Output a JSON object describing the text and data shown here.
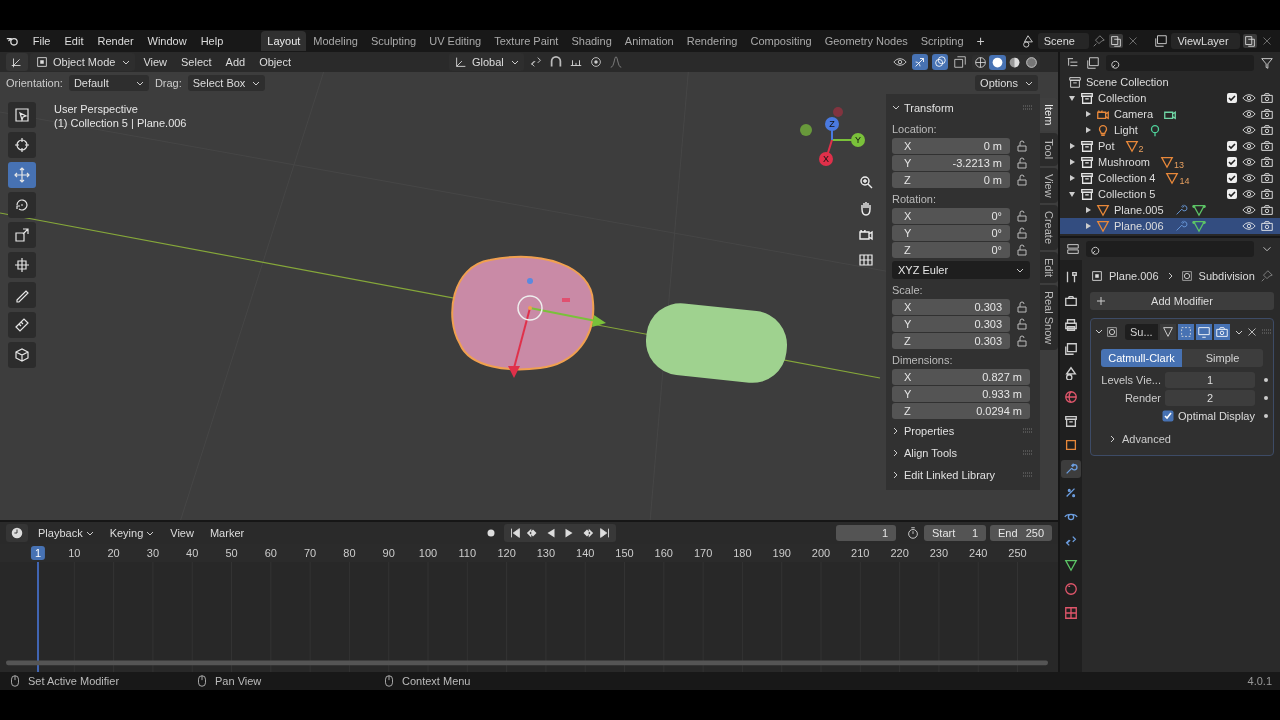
{
  "top_bar": {
    "menus": [
      "File",
      "Edit",
      "Render",
      "Window",
      "Help"
    ],
    "workspaces": [
      {
        "label": "Layout",
        "selected": true
      },
      {
        "label": "Modeling",
        "selected": false
      },
      {
        "label": "Sculpting",
        "selected": false
      },
      {
        "label": "UV Editing",
        "selected": false
      },
      {
        "label": "Texture Paint",
        "selected": false
      },
      {
        "label": "Shading",
        "selected": false
      },
      {
        "label": "Animation",
        "selected": false
      },
      {
        "label": "Rendering",
        "selected": false
      },
      {
        "label": "Compositing",
        "selected": false
      },
      {
        "label": "Geometry Nodes",
        "selected": false
      },
      {
        "label": "Scripting",
        "selected": false
      }
    ],
    "add_workspace": "+",
    "scene": "Scene",
    "view_layer": "ViewLayer"
  },
  "viewport": {
    "mode": "Object Mode",
    "menus": [
      "View",
      "Select",
      "Add",
      "Object"
    ],
    "transform_orientation": "Global",
    "gizmos_on": true,
    "overlays_on": true,
    "shading": [
      {
        "kind": "wireframe",
        "selected": false
      },
      {
        "kind": "solid",
        "selected": true
      },
      {
        "kind": "material",
        "selected": false
      },
      {
        "kind": "rendered",
        "selected": false
      }
    ],
    "orientation_label": "Orientation:",
    "orientation": "Default",
    "drag_label": "Drag:",
    "drag": "Select Box",
    "options": "Options",
    "gizmo_axes": [
      "X",
      "Y",
      "Z"
    ],
    "view_name": "User Perspective",
    "context": "(1) Collection 5 | Plane.006",
    "tools": [
      {
        "kind": "select",
        "selected": false
      },
      {
        "kind": "cursor",
        "selected": false
      },
      {
        "kind": "move",
        "selected": true
      },
      {
        "kind": "rotate",
        "selected": false
      },
      {
        "kind": "scale",
        "selected": false
      },
      {
        "kind": "transform",
        "selected": false
      },
      {
        "kind": "annotate",
        "selected": false
      },
      {
        "kind": "measure",
        "selected": false
      },
      {
        "kind": "add_cube",
        "selected": false
      }
    ]
  },
  "sidebar": {
    "tabs": [
      {
        "label": "Item",
        "selected": true
      },
      {
        "label": "Tool",
        "selected": false
      },
      {
        "label": "View",
        "selected": false
      },
      {
        "label": "Create",
        "selected": false
      },
      {
        "label": "Edit",
        "selected": false
      },
      {
        "label": "Real Snow",
        "selected": false
      }
    ],
    "transform": {
      "title": "Transform",
      "expanded": true,
      "groups": [
        {
          "label": "Location:",
          "lockable": true,
          "fields": [
            {
              "axis": "X",
              "value": "0 m"
            },
            {
              "axis": "Y",
              "value": "-3.2213 m"
            },
            {
              "axis": "Z",
              "value": "0 m"
            }
          ]
        },
        {
          "label": "Rotation:",
          "lockable": true,
          "fields": [
            {
              "axis": "X",
              "value": "0°"
            },
            {
              "axis": "Y",
              "value": "0°"
            },
            {
              "axis": "Z",
              "value": "0°"
            }
          ],
          "mode": "XYZ Euler"
        },
        {
          "label": "Scale:",
          "lockable": true,
          "fields": [
            {
              "axis": "X",
              "value": "0.303"
            },
            {
              "axis": "Y",
              "value": "0.303"
            },
            {
              "axis": "Z",
              "value": "0.303"
            }
          ]
        },
        {
          "label": "Dimensions:",
          "lockable": false,
          "fields": [
            {
              "axis": "X",
              "value": "0.827 m"
            },
            {
              "axis": "Y",
              "value": "0.933 m"
            },
            {
              "axis": "Z",
              "value": "0.0294 m"
            }
          ]
        }
      ]
    },
    "panels": [
      {
        "label": "Properties",
        "expanded": false
      },
      {
        "label": "Align Tools",
        "expanded": false
      },
      {
        "label": "Edit Linked Library",
        "expanded": false
      }
    ]
  },
  "outliner": {
    "root": "Scene Collection",
    "items": [
      {
        "kind": "collection",
        "name": "Collection",
        "expanded": true,
        "selected": false,
        "checked": true,
        "children": [
          {
            "kind": "camera",
            "name": "Camera",
            "expanded": false,
            "selected": false,
            "data": {
              "kind": "camera"
            }
          },
          {
            "kind": "light",
            "name": "Light",
            "expanded": false,
            "selected": false,
            "data": {
              "kind": "light"
            }
          }
        ]
      },
      {
        "kind": "collection",
        "name": "Pot",
        "expanded": false,
        "selected": false,
        "checked": true,
        "data": {
          "kind": "mesh",
          "count": "2"
        }
      },
      {
        "kind": "collection",
        "name": "Mushroom",
        "expanded": false,
        "selected": false,
        "checked": true,
        "data": {
          "kind": "mesh",
          "count": "13"
        }
      },
      {
        "kind": "collection",
        "name": "Collection 4",
        "expanded": false,
        "selected": false,
        "checked": true,
        "data": {
          "kind": "mesh",
          "count": "14"
        }
      },
      {
        "kind": "collection",
        "name": "Collection 5",
        "expanded": true,
        "selected": false,
        "checked": true,
        "children": [
          {
            "kind": "mesh",
            "name": "Plane.005",
            "expanded": false,
            "selected": false,
            "modified": true,
            "data": {
              "kind": "mesh_data"
            }
          },
          {
            "kind": "mesh",
            "name": "Plane.006",
            "expanded": false,
            "selected": true,
            "modified": true,
            "data": {
              "kind": "mesh_data"
            }
          }
        ]
      }
    ]
  },
  "properties": {
    "tabs": [
      {
        "kind": "tool",
        "selected": false
      },
      {
        "kind": "render",
        "selected": false
      },
      {
        "kind": "output",
        "selected": false
      },
      {
        "kind": "view_layer",
        "selected": false
      },
      {
        "kind": "scene",
        "selected": false
      },
      {
        "kind": "world",
        "selected": false
      },
      {
        "kind": "collection",
        "selected": false
      },
      {
        "kind": "object",
        "selected": false
      },
      {
        "kind": "modifiers",
        "selected": true
      },
      {
        "kind": "particles",
        "selected": false
      },
      {
        "kind": "physics",
        "selected": false
      },
      {
        "kind": "constraints",
        "selected": false
      },
      {
        "kind": "data",
        "selected": false
      },
      {
        "kind": "material",
        "selected": false
      },
      {
        "kind": "texture",
        "selected": false
      }
    ],
    "object": "Plane.006",
    "modifier_name": "Subdivision",
    "add_modifier": "Add Modifier",
    "modifier": {
      "name": "Su...",
      "expanded": true,
      "types": [
        {
          "label": "Catmull-Clark",
          "selected": true
        },
        {
          "label": "Simple",
          "selected": false
        }
      ],
      "fields": [
        {
          "label": "Levels Vie...",
          "value": "1"
        },
        {
          "label": "Render",
          "value": "2"
        }
      ],
      "optimal_display": {
        "label": "Optimal Display",
        "checked": true
      },
      "advanced": {
        "label": "Advanced",
        "expanded": false
      }
    }
  },
  "timeline": {
    "menus": [
      "Playback",
      "Keying",
      "View",
      "Marker"
    ],
    "current_frame": "1",
    "start_label": "Start",
    "start": "1",
    "end_label": "End",
    "end": "250",
    "ruler": [
      "1",
      "10",
      "20",
      "30",
      "40",
      "50",
      "60",
      "70",
      "80",
      "90",
      "100",
      "110",
      "120",
      "130",
      "140",
      "150",
      "160",
      "170",
      "180",
      "190",
      "200",
      "210",
      "220",
      "230",
      "240",
      "250"
    ]
  },
  "status_bar": {
    "hints": [
      "Set Active Modifier",
      "Pan View",
      "Context Menu"
    ],
    "version": "4.0.1"
  }
}
